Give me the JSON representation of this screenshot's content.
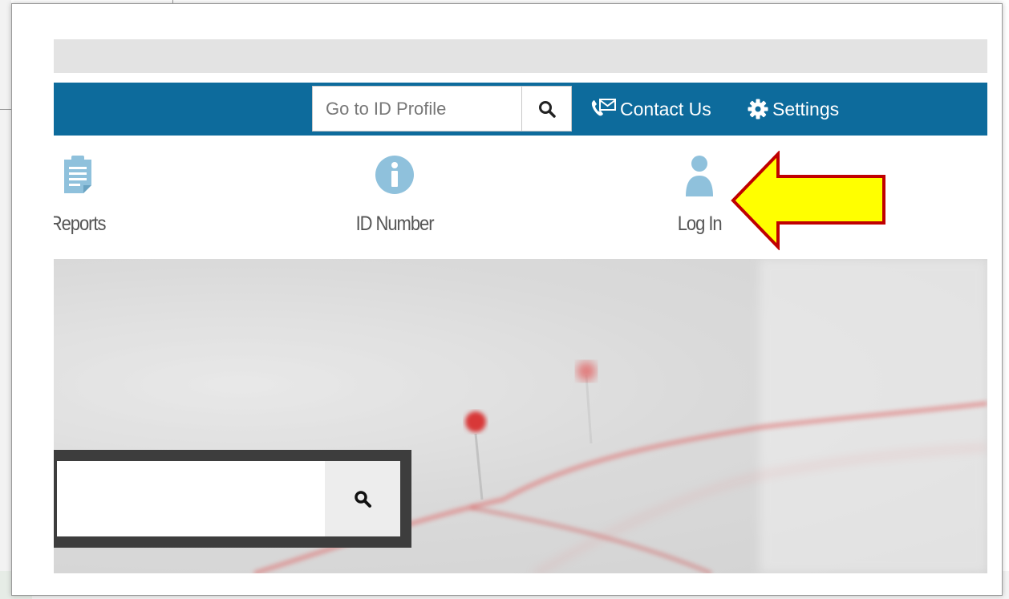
{
  "top_nav": {
    "id_search": {
      "placeholder": "Go to ID Profile",
      "icon": "search-icon"
    },
    "contact_label": "Contact Us",
    "contact_icon": "phone-mail-icon",
    "settings_label": "Settings",
    "settings_icon": "gear-icon"
  },
  "icon_nav": {
    "items": [
      {
        "label": "Reports",
        "icon": "clipboard-icon"
      },
      {
        "label": "ID Number",
        "icon": "info-icon"
      },
      {
        "label": "Log In",
        "icon": "user-icon"
      }
    ]
  },
  "hero": {
    "search": {
      "placeholder": "",
      "icon": "search-icon"
    }
  },
  "annotation": {
    "icon": "arrow-left-icon",
    "fill": "#ffff00",
    "stroke": "#c00000"
  },
  "colors": {
    "nav_bg": "#0d6b9c",
    "icon_blue": "#8fc1dc",
    "hero_frame": "#3d3d3d"
  }
}
